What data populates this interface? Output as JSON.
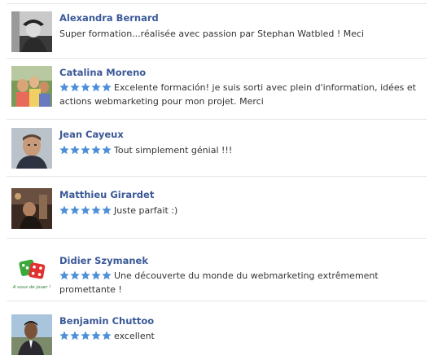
{
  "reviews": [
    {
      "name": "Alexandra Bernard",
      "text": "Super formation...réalisée avec passion par Stephan Watbled ! Meci",
      "stars": 0
    },
    {
      "name": "Catalina Moreno",
      "text": "Excelente formación! je suis sorti avec plein d'information, idées et actions webmarketing pour mon projet. Merci",
      "stars": 5
    },
    {
      "name": "Jean Cayeux",
      "text": "Tout simplement génial !!!",
      "stars": 5
    },
    {
      "name": "Matthieu Girardet",
      "text": "Juste parfait :)",
      "stars": 5
    },
    {
      "name": "Didier Szymanek",
      "text": "Une découverte du monde du webmarketing extrêmement promettante !",
      "stars": 5,
      "avatar_caption": "A vous de jouer !"
    },
    {
      "name": "Benjamin Chuttoo",
      "text": "excellent",
      "stars": 5
    }
  ],
  "colors": {
    "name": "#3b5998",
    "star": "#4c8fd6",
    "divider": "#e4e6eb"
  }
}
